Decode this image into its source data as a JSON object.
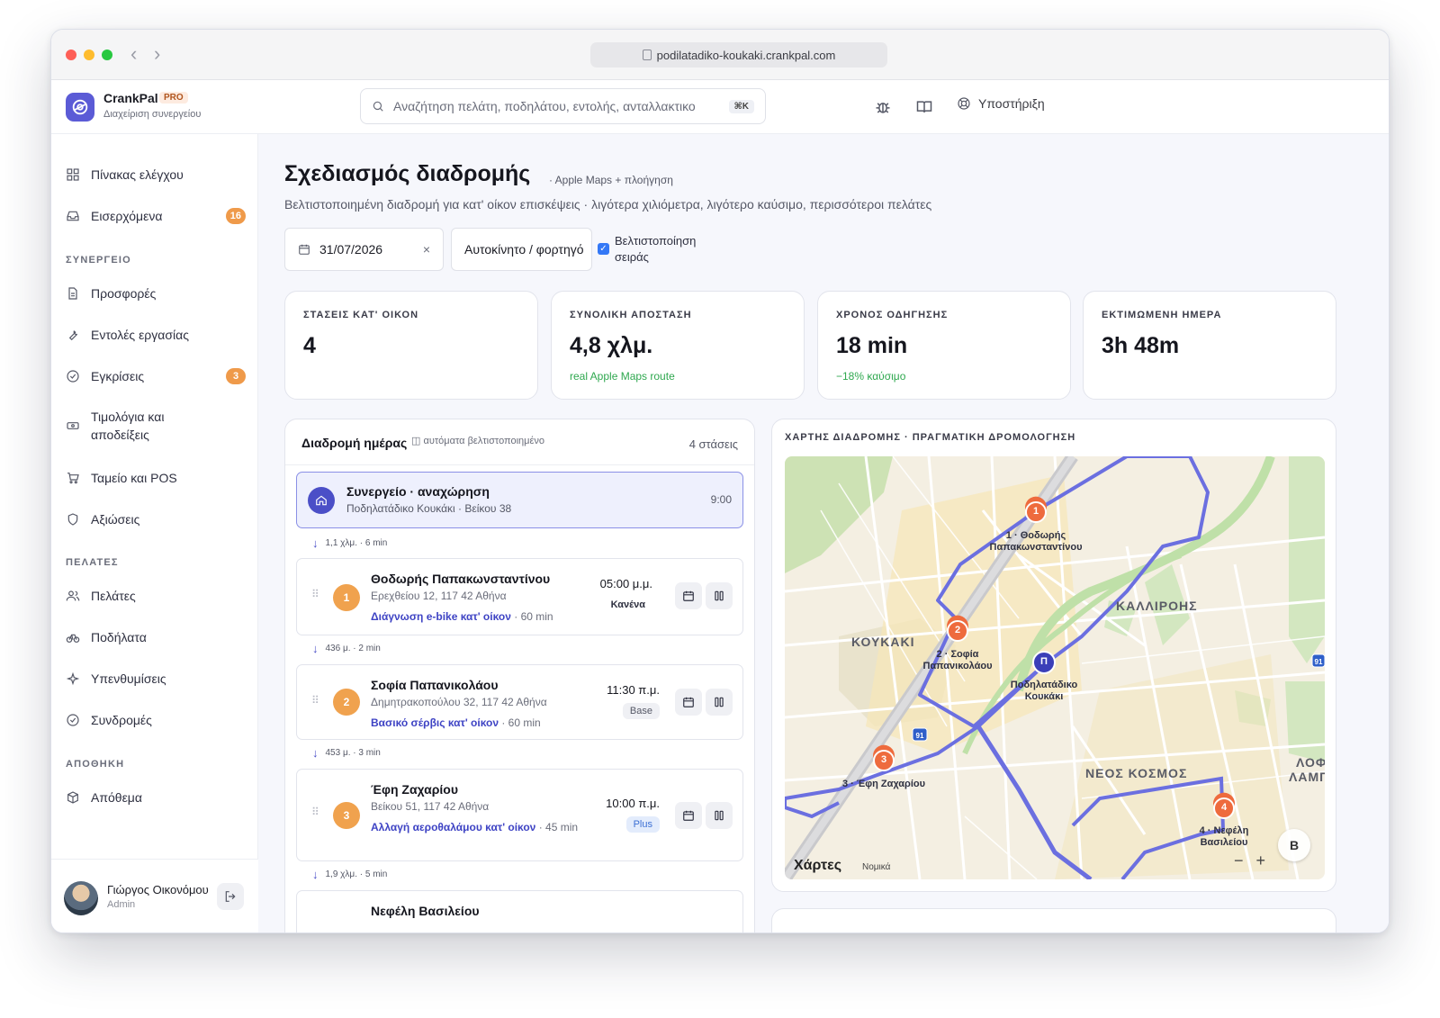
{
  "browser": {
    "url": "podilatadiko-koukaki.crankpal.com"
  },
  "brand": {
    "name": "CrankPal",
    "badge": "PRO",
    "subtitle": "Διαχείριση συνεργείου"
  },
  "search": {
    "placeholder": "Αναζήτηση πελάτη, ποδηλάτου, εντολής, ανταλλακτικο",
    "shortcut": "⌘K"
  },
  "header": {
    "support_label": "Υποστήριξη"
  },
  "sidebar": {
    "top_items": [
      {
        "label": "Πίνακας ελέγχου",
        "icon": "dashboard-icon"
      },
      {
        "label": "Εισερχόμενα",
        "icon": "inbox-icon",
        "badge": "16"
      }
    ],
    "sections": [
      {
        "title": "ΣΥΝΕΡΓΕΙΟ",
        "items": [
          {
            "label": "Προσφορές",
            "icon": "document-icon"
          },
          {
            "label": "Εντολές εργασίας",
            "icon": "wrench-icon"
          },
          {
            "label": "Εγκρίσεις",
            "icon": "check-circle-icon",
            "badge": "3"
          },
          {
            "label": "Τιμολόγια και αποδείξεις",
            "icon": "cash-icon"
          },
          {
            "label": "Ταμείο και POS",
            "icon": "cart-icon"
          },
          {
            "label": "Αξιώσεις",
            "icon": "shield-icon"
          }
        ]
      },
      {
        "title": "ΠΕΛΑΤΕΣ",
        "items": [
          {
            "label": "Πελάτες",
            "icon": "users-icon"
          },
          {
            "label": "Ποδήλατα",
            "icon": "bike-icon"
          },
          {
            "label": "Υπενθυμίσεις",
            "icon": "sparkle-icon"
          },
          {
            "label": "Συνδρομές",
            "icon": "check-circle-icon"
          }
        ]
      },
      {
        "title": "ΑΠΟΘΗΚΗ",
        "items": [
          {
            "label": "Απόθεμα",
            "icon": "box-icon"
          }
        ]
      }
    ],
    "user": {
      "name": "Γιώργος Οικονόμου",
      "role": "Admin"
    }
  },
  "page": {
    "title": "Σχεδιασμός διαδρομής",
    "title_note": "· Apple Maps + πλοήγηση",
    "subtitle": "Βελτιστοποιημένη διαδρομή για κατ' οίκον επισκέψεις · λιγότερα χιλιόμετρα, λιγότερο καύσιμο, περισσότεροι πελάτες",
    "date": "31/07/2026",
    "vehicle": "Αυτοκίνητο / φορτηγό",
    "optimize_label_1": "Βελτιστοποίηση",
    "optimize_label_2": "σειράς",
    "optimize_checked": true
  },
  "stats": [
    {
      "label": "ΣΤΑΣΕΙΣ ΚΑΤ' ΟΙΚΟΝ",
      "value": "4",
      "note": ""
    },
    {
      "label": "ΣΥΝΟΛΙΚΗ ΑΠΟΣΤΑΣΗ",
      "value": "4,8 χλμ.",
      "note": "real Apple Maps route"
    },
    {
      "label": "ΧΡΟΝΟΣ ΟΔΗΓΗΣΗΣ",
      "value": "18 min",
      "note": "−18% καύσιμο"
    },
    {
      "label": "ΕΚΤΙΜΩΜΕΝΗ ΗΜΕΡΑ",
      "value": "3h 48m",
      "note": ""
    }
  ],
  "route": {
    "title": "Διαδρομή ημέρας",
    "auto_note": "αυτόματα βελτιστοποιημένο",
    "count": "4 στάσεις",
    "depot": {
      "title": "Συνεργείο · αναχώρηση",
      "address": "Ποδηλατάδικο Κουκάκι · Βείκου 38",
      "time": "9:00"
    },
    "legs": [
      "1,1 χλμ. · 6 min",
      "436 μ. · 2 min",
      "453 μ. · 3 min",
      "1,9 χλμ. · 5 min"
    ],
    "stops": [
      {
        "num": "1",
        "name": "Θοδωρής Παπακωνσταντίνου",
        "address": "Ερεχθείου 12, 117 42 Αθήνα",
        "service": "Διάγνωση e-bike κατ' οίκον",
        "duration": "· 60 min",
        "time": "05:00 μ.μ.",
        "tag": "Κανένα"
      },
      {
        "num": "2",
        "name": "Σοφία Παπανικολάου",
        "address": "Δημητρακοπούλου 32, 117 42 Αθήνα",
        "service": "Βασικό σέρβις κατ' οίκον",
        "duration": "· 60 min",
        "time": "11:30 π.μ.",
        "tag": "Base"
      },
      {
        "num": "3",
        "name": "Έφη Ζαχαρίου",
        "address": "Βείκου 51, 117 42 Αθήνα",
        "service": "Αλλαγή αεροθαλάμου κατ' οίκον",
        "duration": "· 45 min",
        "time": "10:00 π.μ.",
        "tag": "Plus"
      },
      {
        "num": "4",
        "name": "Νεφέλη Βασιλείου"
      }
    ]
  },
  "map": {
    "label": "ΧΑΡΤΗΣ ΔΙΑΔΡΟΜΗΣ · ΠΡΑΓΜΑΤΙΚΗ ΔΡΟΜΟΛΟΓΗΣΗ",
    "areas": [
      "ΚΟΥΚΑΚΙ",
      "ΚΑΛΛΙΡΟΗΣ",
      "ΝΕΟΣ ΚΟΣΜΟΣ",
      "ΛΟΦ",
      "ΛΑΜΠΡ"
    ],
    "pins": [
      {
        "num": "1",
        "label_1": "1 · Θοδωρής",
        "label_2": "Παπακωνσταντίνου"
      },
      {
        "num": "2",
        "label_1": "2 · Σοφία",
        "label_2": "Παπανικολάου"
      },
      {
        "num": "3",
        "label_1": "3 · Έφη Ζαχαρίου",
        "label_2": ""
      },
      {
        "num": "4",
        "label_1": "4 · Νεφέλη",
        "label_2": "Βασιλείου"
      }
    ],
    "depot_pin": {
      "letter": "Π",
      "label_1": "Ποδηλατάδικο",
      "label_2": "Κουκάκι"
    },
    "route_badge": "91",
    "attribution": "Χάρτες",
    "legal": "Νομικά",
    "compass": "Β",
    "zoom_out": "−",
    "zoom_in": "+",
    "route_color": "#6b6fe0",
    "pin_color": "#ee6b3d"
  }
}
